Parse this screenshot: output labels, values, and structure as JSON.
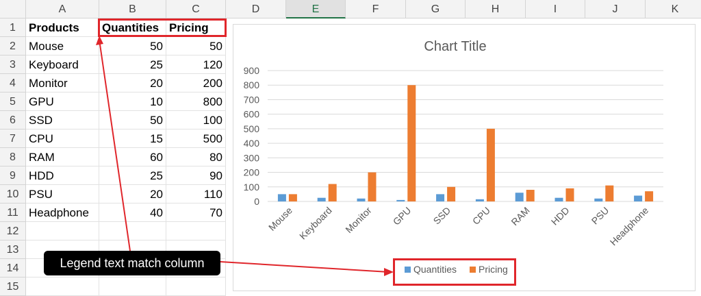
{
  "columns": [
    "A",
    "B",
    "C",
    "D",
    "E",
    "F",
    "G",
    "H",
    "I",
    "J",
    "K"
  ],
  "selected_column": "E",
  "rows": [
    "1",
    "2",
    "3",
    "4",
    "5",
    "6",
    "7",
    "8",
    "9",
    "10",
    "11",
    "12",
    "13",
    "14",
    "15"
  ],
  "headers": {
    "a": "Products",
    "b": "Quantities",
    "c": "Pricing"
  },
  "table": [
    {
      "product": "Mouse",
      "qty": "50",
      "price": "50"
    },
    {
      "product": "Keyboard",
      "qty": "25",
      "price": "120"
    },
    {
      "product": "Monitor",
      "qty": "20",
      "price": "200"
    },
    {
      "product": "GPU",
      "qty": "10",
      "price": "800"
    },
    {
      "product": "SSD",
      "qty": "50",
      "price": "100"
    },
    {
      "product": "CPU",
      "qty": "15",
      "price": "500"
    },
    {
      "product": "RAM",
      "qty": "60",
      "price": "80"
    },
    {
      "product": "HDD",
      "qty": "25",
      "price": "90"
    },
    {
      "product": "PSU",
      "qty": "20",
      "price": "110"
    },
    {
      "product": "Headphone",
      "qty": "40",
      "price": "70"
    }
  ],
  "callout": {
    "text": "Legend text match column"
  },
  "colors": {
    "quantities": "#5b9bd5",
    "pricing": "#ed7d31",
    "annotation": "#e0262b",
    "selected_header": "#217346"
  },
  "chart_data": {
    "type": "bar",
    "title": "Chart Title",
    "categories": [
      "Mouse",
      "Keyboard",
      "Monitor",
      "GPU",
      "SSD",
      "CPU",
      "RAM",
      "HDD",
      "PSU",
      "Headphone"
    ],
    "series": [
      {
        "name": "Quantities",
        "values": [
          50,
          25,
          20,
          10,
          50,
          15,
          60,
          25,
          20,
          40
        ]
      },
      {
        "name": "Pricing",
        "values": [
          50,
          120,
          200,
          800,
          100,
          500,
          80,
          90,
          110,
          70
        ]
      }
    ],
    "ylim": [
      0,
      900
    ],
    "yticks": [
      "0",
      "100",
      "200",
      "300",
      "400",
      "500",
      "600",
      "700",
      "800",
      "900"
    ],
    "grid": true,
    "legend_position": "bottom"
  }
}
